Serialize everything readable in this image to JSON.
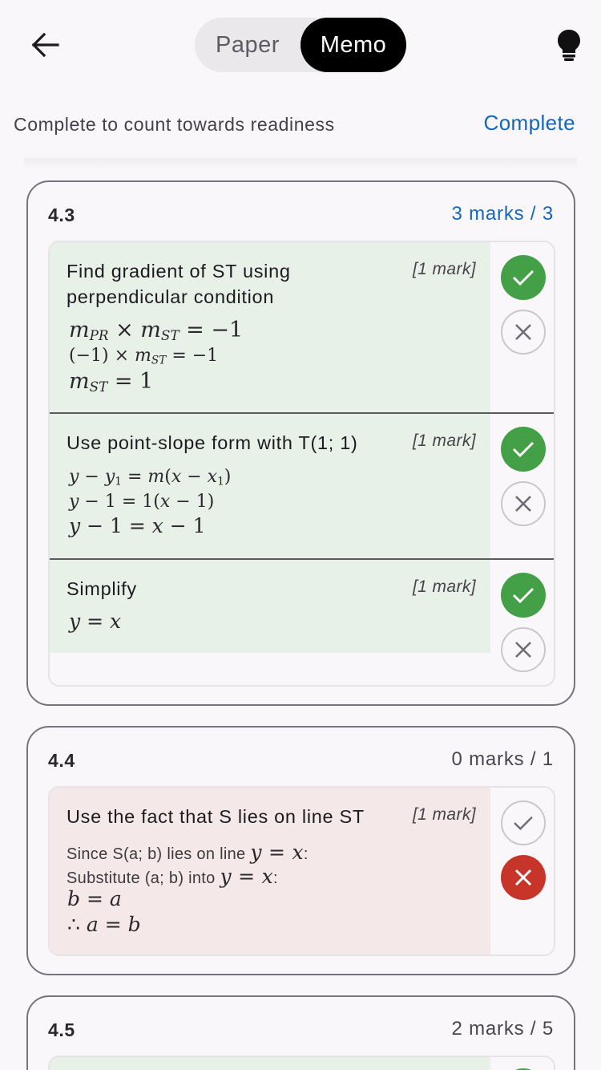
{
  "header": {
    "back_icon": "arrow-left-icon",
    "toggle": {
      "paper_label": "Paper",
      "memo_label": "Memo",
      "selected": "Memo"
    },
    "hint_icon": "lightbulb-icon"
  },
  "readiness": {
    "text": "Complete to count towards readiness",
    "action_label": "Complete"
  },
  "colors": {
    "accent": "#1567b8",
    "correct": "#43a047",
    "wrong": "#c7352a",
    "correct_bg": "#e8f1e8",
    "wrong_bg": "#f4e9e8"
  },
  "questions": [
    {
      "number": "4.3",
      "marks": "3 marks / 3",
      "steps": [
        {
          "title": "Find gradient of ST using perpendicular condition",
          "mark": "[1 mark]",
          "status": "correct",
          "math": [
            "m_PR × m_ST = −1",
            "(−1) × m_ST = −1",
            "m_ST = 1"
          ]
        },
        {
          "title": "Use point-slope form with T(1; 1)",
          "mark": "[1 mark]",
          "status": "correct",
          "math": [
            "y − y₁ = m(x − x₁)",
            "y − 1 = 1(x − 1)",
            "y − 1 = x − 1"
          ]
        },
        {
          "title": "Simplify",
          "mark": "[1 mark]",
          "status": "correct",
          "math": [
            "y = x"
          ]
        }
      ]
    },
    {
      "number": "4.4",
      "marks": "0 marks / 1",
      "steps": [
        {
          "title": "Use the fact that S lies on line ST",
          "mark": "[1 mark]",
          "status": "wrong",
          "lines": [
            {
              "text": "Since S(a; b) lies on line",
              "math": "y = x",
              "suffix": ":"
            },
            {
              "text": "Substitute (a; b) into",
              "math": "y = x",
              "suffix": ":"
            }
          ],
          "math": [
            "b = a",
            "∴ a = b"
          ]
        }
      ]
    },
    {
      "number": "4.5",
      "marks": "2 marks / 5"
    }
  ]
}
